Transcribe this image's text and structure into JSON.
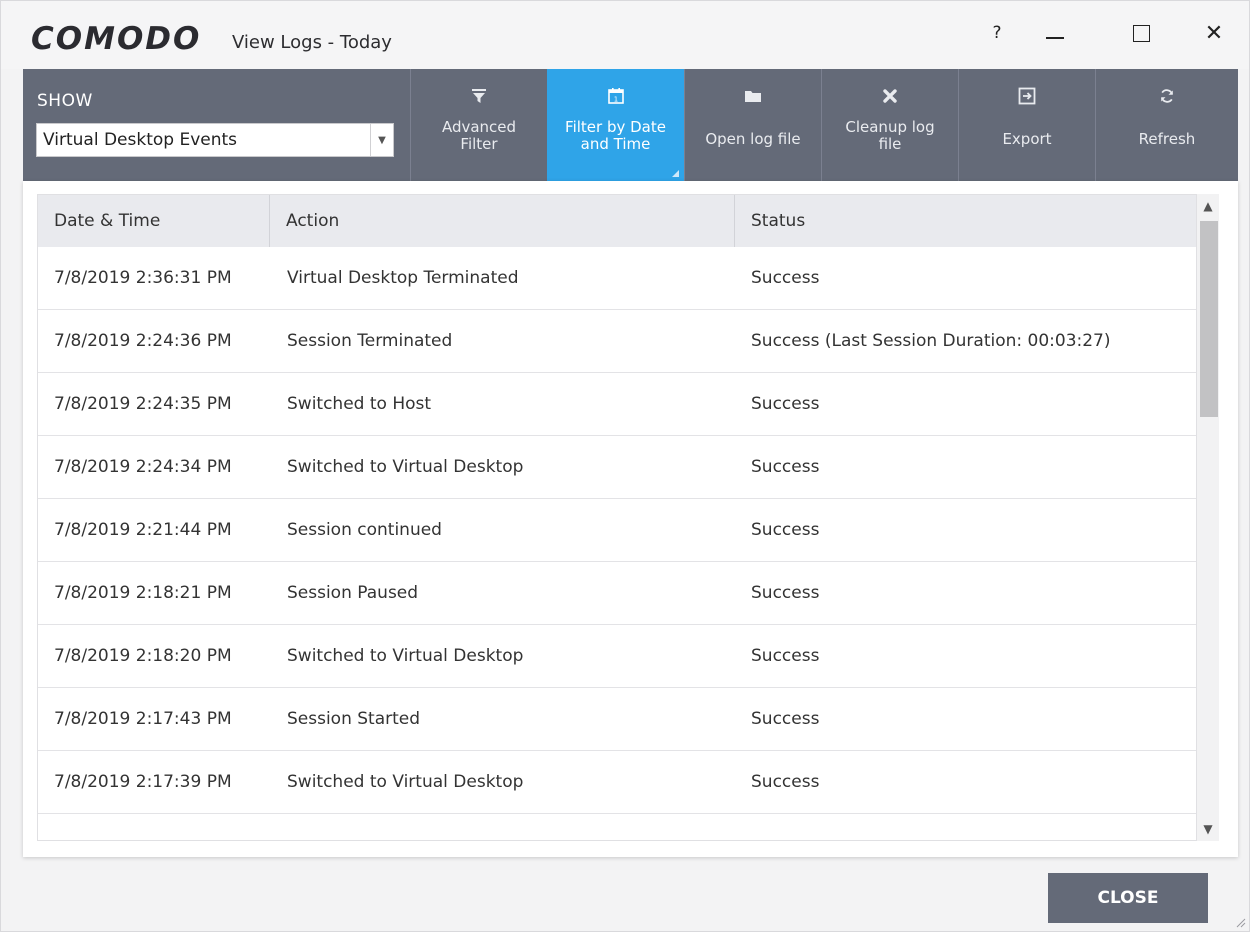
{
  "window": {
    "brand": "COMODO",
    "title": "View Logs - Today",
    "controls": {
      "help": "?",
      "close": "✕"
    }
  },
  "toolbar": {
    "show_label": "SHOW",
    "show_select_value": "Virtual Desktop Events",
    "buttons": [
      {
        "label": "Advanced\nFilter",
        "icon": "filter-icon"
      },
      {
        "label": "Filter by Date\nand Time",
        "icon": "calendar-icon",
        "active": true
      },
      {
        "label": "Open log file",
        "icon": "folder-icon"
      },
      {
        "label": "Cleanup log\nfile",
        "icon": "x-mark-icon"
      },
      {
        "label": "Export",
        "icon": "export-icon"
      },
      {
        "label": "Refresh",
        "icon": "refresh-icon"
      }
    ]
  },
  "table": {
    "columns": [
      "Date & Time",
      "Action",
      "Status"
    ],
    "rows": [
      [
        "7/8/2019 2:36:31 PM",
        "Virtual Desktop Terminated",
        "Success"
      ],
      [
        "7/8/2019 2:24:36 PM",
        "Session Terminated",
        "Success (Last Session Duration: 00:03:27)"
      ],
      [
        "7/8/2019 2:24:35 PM",
        "Switched to Host",
        "Success"
      ],
      [
        "7/8/2019 2:24:34 PM",
        "Switched to Virtual Desktop",
        "Success"
      ],
      [
        "7/8/2019 2:21:44 PM",
        "Session continued",
        "Success"
      ],
      [
        "7/8/2019 2:18:21 PM",
        "Session Paused",
        "Success"
      ],
      [
        "7/8/2019 2:18:20 PM",
        "Switched to Virtual Desktop",
        "Success"
      ],
      [
        "7/8/2019 2:17:43 PM",
        "Session Started",
        "Success"
      ],
      [
        "7/8/2019 2:17:39 PM",
        "Switched to Virtual Desktop",
        "Success"
      ]
    ]
  },
  "footer": {
    "close_label": "CLOSE"
  },
  "colors": {
    "toolbar_bg": "#646a78",
    "active_button": "#2fa4e8",
    "close_button": "#646a78"
  }
}
